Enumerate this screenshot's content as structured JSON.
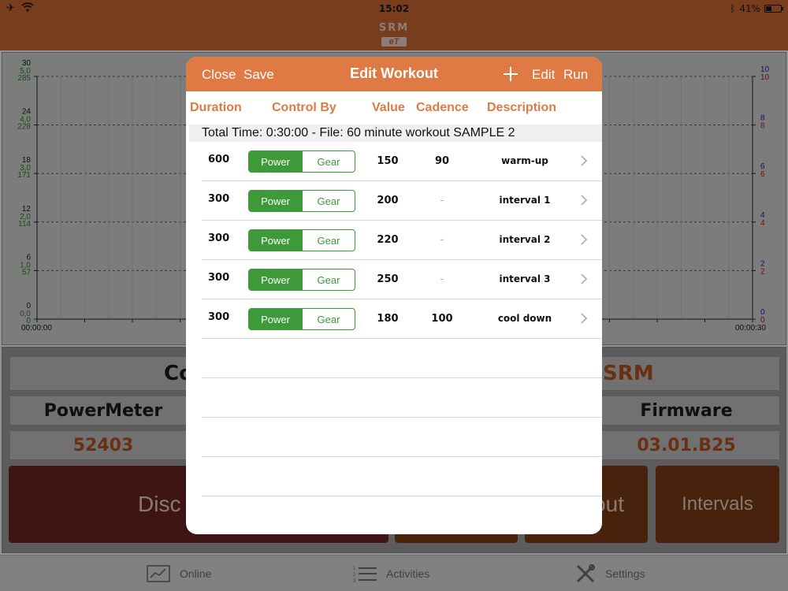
{
  "status_bar": {
    "time": "15:02",
    "battery": "41%",
    "battery_level": 0.41
  },
  "app": {
    "logo_top": "SRM",
    "logo_bottom": "eT"
  },
  "chart_data": {
    "type": "line",
    "series": [],
    "x_ticks": [
      "00:00:00",
      "00:00:30"
    ],
    "left_axis": {
      "black": [
        "30",
        "24",
        "18",
        "12",
        "6",
        "0"
      ],
      "green_top": [
        "5,0",
        "4,0",
        "3,0",
        "2,0",
        "1,0",
        "0,0"
      ],
      "green_bottom": [
        "285",
        "228",
        "171",
        "114",
        "57",
        "0"
      ]
    },
    "right_axis": {
      "blue": [
        "10",
        "8",
        "6",
        "4",
        "2",
        "0"
      ],
      "red": [
        "10",
        "8",
        "6",
        "4",
        "2",
        "0"
      ]
    },
    "grid": true
  },
  "info": {
    "row1_left": "Co",
    "row1_right": "SRM",
    "powermeter_label": "PowerMeter",
    "firmware_label": "Firmware",
    "powermeter_value": "52403",
    "firmware_value": "03.01.B25",
    "btn_disconnect": "Disc",
    "btn_workout": "out",
    "btn_intervals": "Intervals"
  },
  "colors": {
    "orange": "#e07a45",
    "green": "#3e9a38",
    "disconnect_red": "#a32a2a",
    "button_orange": "#b8531f"
  },
  "tabs": [
    {
      "label": "Online",
      "icon": "chart-icon"
    },
    {
      "label": "Activities",
      "icon": "list-icon"
    },
    {
      "label": "Settings",
      "icon": "tools-icon"
    }
  ],
  "modal": {
    "close_label": "Close",
    "save_label": "Save",
    "title": "Edit Workout",
    "edit_label": "Edit",
    "run_label": "Run",
    "columns": {
      "duration": "Duration",
      "control": "Control By",
      "value": "Value",
      "cadence": "Cadence",
      "description": "Description"
    },
    "summary": "Total Time: 0:30:00  -  File: 60 minute workout SAMPLE 2",
    "segment_on": "Power",
    "segment_off": "Gear",
    "rows": [
      {
        "duration": "600",
        "value": "150",
        "cadence": "90",
        "description": "warm-up"
      },
      {
        "duration": "300",
        "value": "200",
        "cadence": "-",
        "description": "interval 1"
      },
      {
        "duration": "300",
        "value": "220",
        "cadence": "-",
        "description": "interval 2"
      },
      {
        "duration": "300",
        "value": "250",
        "cadence": "-",
        "description": "interval 3"
      },
      {
        "duration": "300",
        "value": "180",
        "cadence": "100",
        "description": "cool down"
      }
    ]
  }
}
